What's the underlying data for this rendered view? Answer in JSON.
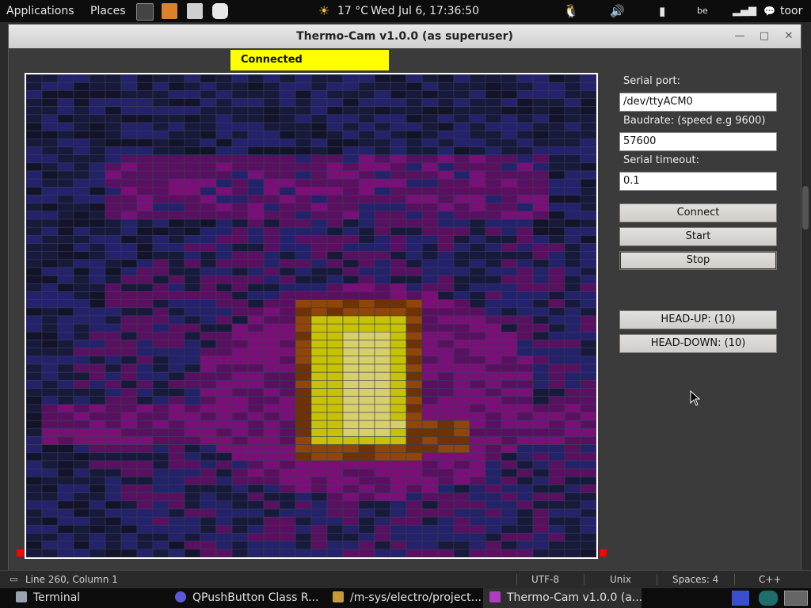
{
  "top_panel": {
    "applications_label": "Applications",
    "places_label": "Places",
    "weather": "17 °C",
    "clock": "Wed Jul  6, 17:36:50",
    "keyboard_layout": "be",
    "user": "toor"
  },
  "window": {
    "title": "Thermo-Cam v1.0.0 (as superuser)",
    "minimize_glyph": "—",
    "maximize_glyph": "□",
    "close_glyph": "✕"
  },
  "status": {
    "label": "Connected",
    "color": "#ffff00"
  },
  "controls": {
    "serial_port_label": "Serial port:",
    "serial_port_value": "/dev/ttyACM0",
    "baudrate_label": "Baudrate: (speed e.g 9600)",
    "baudrate_value": "57600",
    "timeout_label": "Serial timeout:",
    "timeout_value": "0.1",
    "connect_label": "Connect",
    "start_label": "Start",
    "stop_label": "Stop",
    "head_up_label": "HEAD-UP: (10)",
    "head_down_label": "HEAD-DOWN: (10)"
  },
  "heatmap": {
    "rows": 60,
    "cols": 36,
    "palette": {
      "background": "#171a3a",
      "dark": "#13132a",
      "blue": "#23226a",
      "purple": "#5a1060",
      "magenta": "#7a0f78",
      "orange": "#8f4608",
      "dark_orange": "#6e3203",
      "yellow": "#c7c206",
      "light_yellow": "#d7d06a",
      "grid": "#3a3d58"
    }
  },
  "editor_status": {
    "position": "Line 260, Column 1",
    "encoding": "UTF-8",
    "line_endings": "Unix",
    "indentation": "Spaces: 4",
    "syntax": "C++"
  },
  "taskbar": {
    "items": [
      {
        "label": "Terminal",
        "icon_color": "#9aa3ad"
      },
      {
        "label": "QPushButton Class R...",
        "icon_color": "#5a5ad8"
      },
      {
        "label": "/m-sys/electro/project...",
        "icon_color": "#c49a3a"
      },
      {
        "label": "Thermo-Cam v1.0.0 (a...",
        "icon_color": "#b03dbf"
      }
    ]
  }
}
